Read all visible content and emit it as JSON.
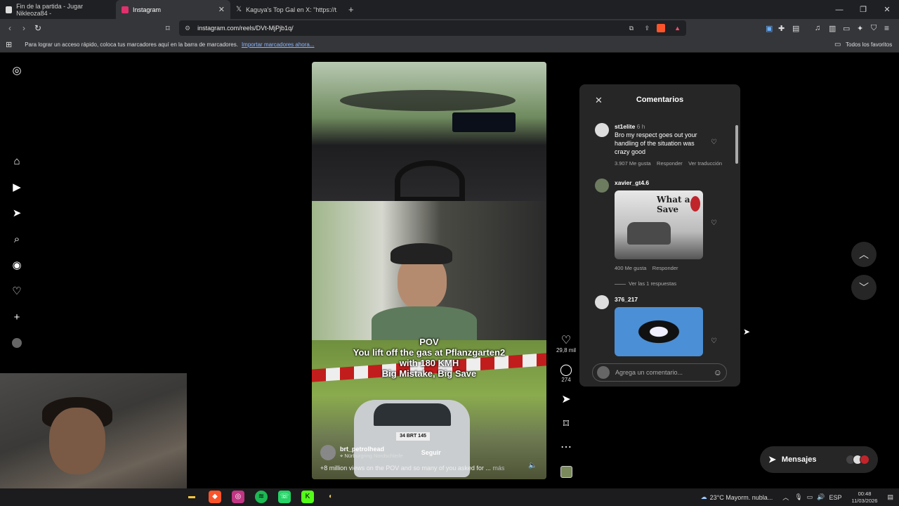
{
  "browser": {
    "tabs": [
      {
        "label": "Fin de la partida - Jugar Nikleoza84 -",
        "color": "#e8e8e8"
      },
      {
        "label": "Instagram",
        "color": "#e1306c"
      },
      {
        "label": "Kaguya's Top Gal en X: \"https://t.co/...",
        "color": "#ffffff"
      }
    ],
    "new_tab": "+",
    "url": "instagram.com/reels/DVt-MjPjb1q/",
    "bookmarks_prompt": "Para lograr un acceso rápido, coloca tus marcadores aquí en la barra de marcadores.",
    "bookmarks_link": "Importar marcadores ahora...",
    "all_bookmarks": "Todos los favoritos"
  },
  "sidebar": {
    "icons": [
      "instagram-icon",
      "home-icon",
      "reels-icon",
      "send-icon",
      "search-icon",
      "explore-icon",
      "heart-icon",
      "plus-icon",
      "profile-avatar"
    ]
  },
  "reel": {
    "pov_text": "POV\nYou lift off the gas at Pflanzgarten2\nwith 180 KMH\nBig Mistake, Big Save",
    "plate": "34 BRT 145",
    "username": "brt_petrolhead",
    "location": "Nürburgring Nordschleife",
    "follow_label": "Seguir",
    "caption": "+8 million views on the POV and so many of you asked for ...",
    "more_label": "más",
    "likes": "29,8 mil",
    "comments_count": "274"
  },
  "comments_panel": {
    "title": "Comentarios",
    "items": [
      {
        "user": "st1elite",
        "time": "6 h",
        "text": "Bro my respect goes out your handling of the situation was crazy good",
        "likes": "3.907 Me gusta",
        "reply": "Responder",
        "translate": "Ver traducción"
      },
      {
        "user": "xavier_gt4.6",
        "gif_caption": "What a Save",
        "likes": "400 Me gusta",
        "reply": "Responder",
        "view_replies": "Ver las 1 respuestas"
      },
      {
        "user": "376_217"
      }
    ],
    "input_placeholder": "Agrega un comentario..."
  },
  "messages_label": "Mensajes",
  "taskbar": {
    "weather": "23°C  Mayorm. nubla...",
    "lang": "ESP",
    "time": "00:48",
    "date": "11/03/2026"
  }
}
